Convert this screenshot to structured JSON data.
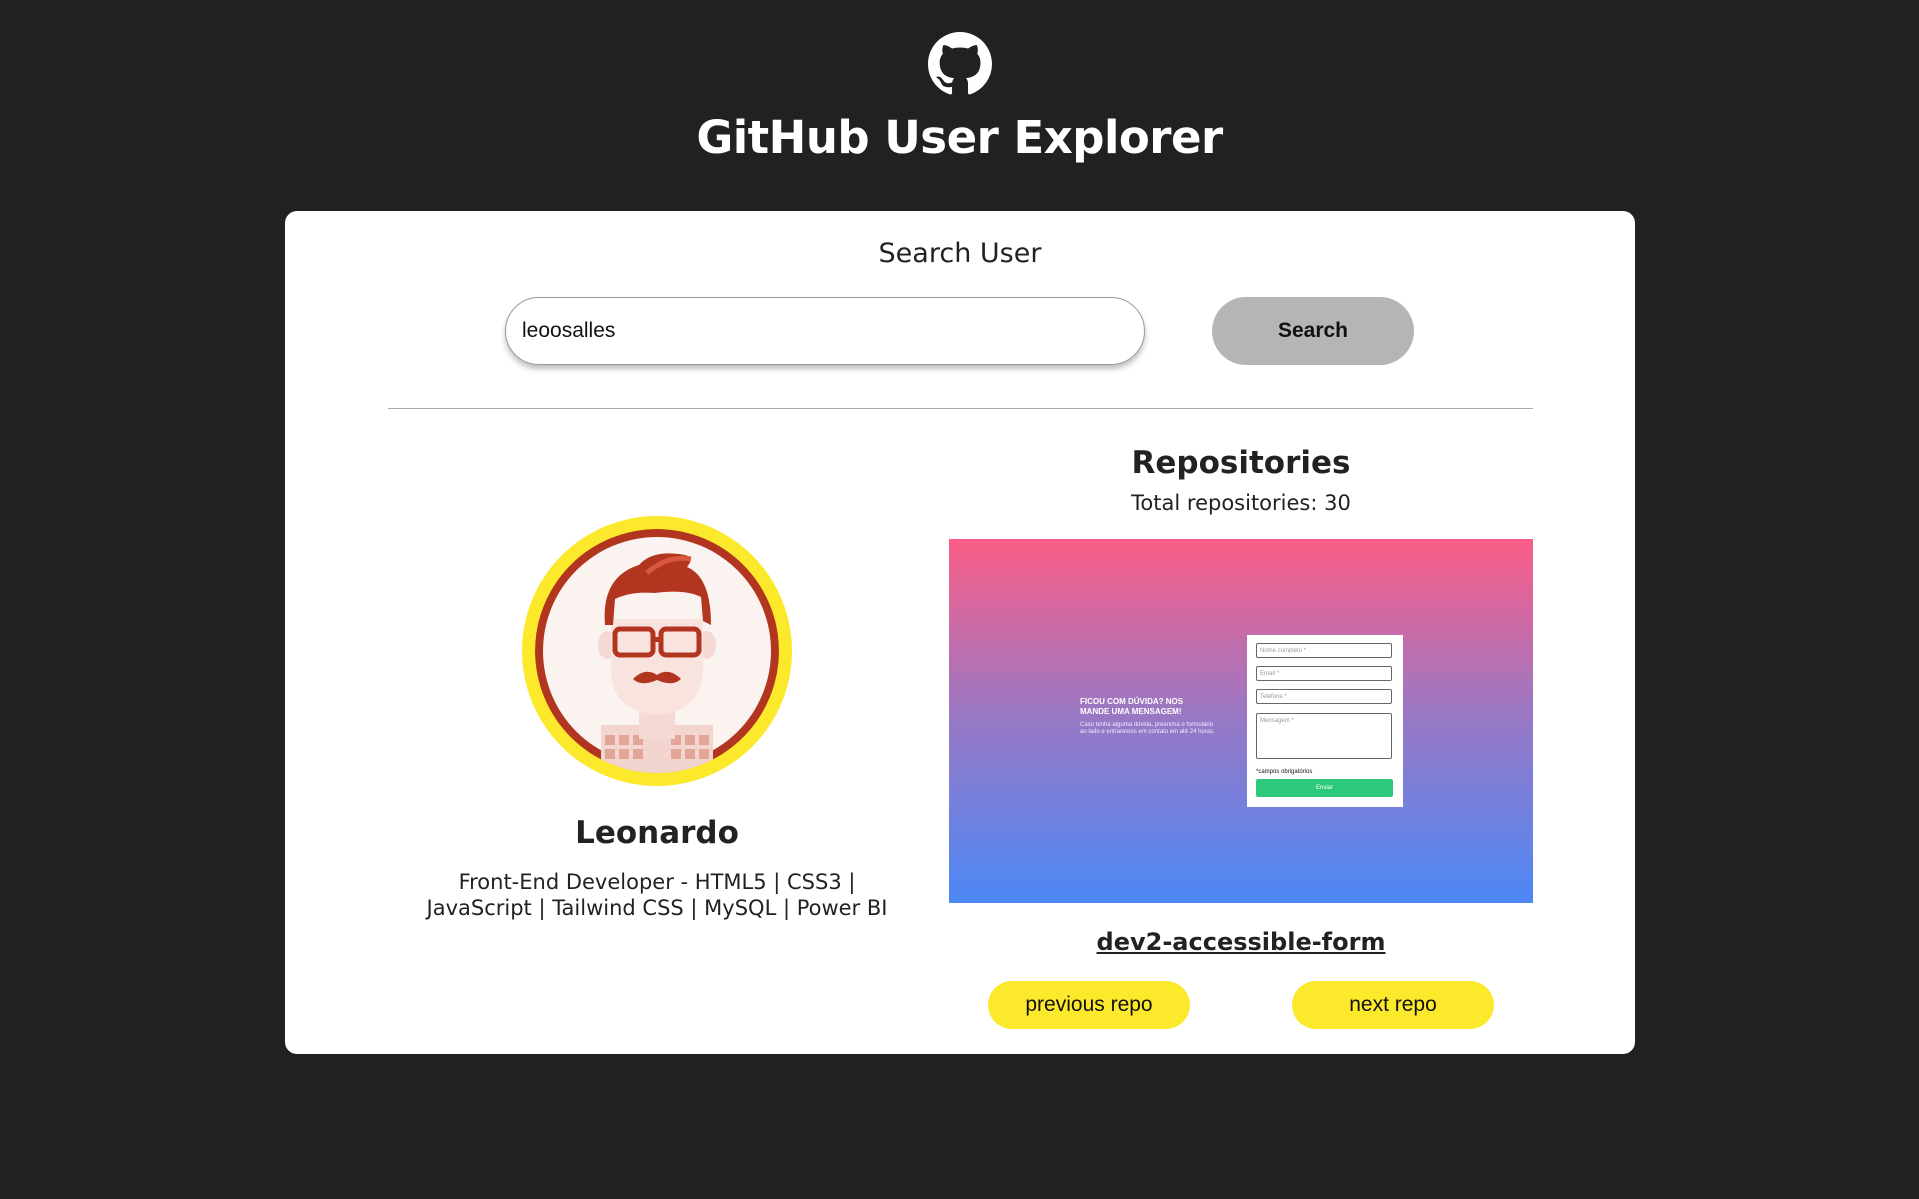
{
  "app": {
    "title": "GitHub User Explorer",
    "logo_icon": "github-octocat-icon"
  },
  "search": {
    "heading": "Search User",
    "input_value": "leoosalles",
    "button_label": "Search"
  },
  "profile": {
    "name": "Leonardo",
    "bio": "Front-End Developer - HTML5 | CSS3 | JavaScript | Tailwind CSS | MySQL | Power BI",
    "avatar_icon": "hipster-avatar-illustration",
    "ring_color": "#fce92c"
  },
  "repositories": {
    "heading": "Repositories",
    "total_label": "Total repositories: 30",
    "current_repo": {
      "name": "dev2-accessible-form",
      "preview": {
        "heading": "FICOU COM DÚVIDA? NOS MANDE UMA MENSAGEM!",
        "text": "Caso tenha alguma dúvida, preencha o formulário ao lado e entraremos em contato em até 24 horas.",
        "fields": [
          "Nome completo *",
          "Email *",
          "Telefone *",
          "Mensagem *"
        ],
        "required_note": "*campos obrigatórios",
        "send_label": "Enviar"
      }
    },
    "prev_label": "previous repo",
    "next_label": "next repo"
  },
  "colors": {
    "background": "#212121",
    "card": "#ffffff",
    "accent": "#fce92c",
    "search_button": "#b5b5b5"
  }
}
